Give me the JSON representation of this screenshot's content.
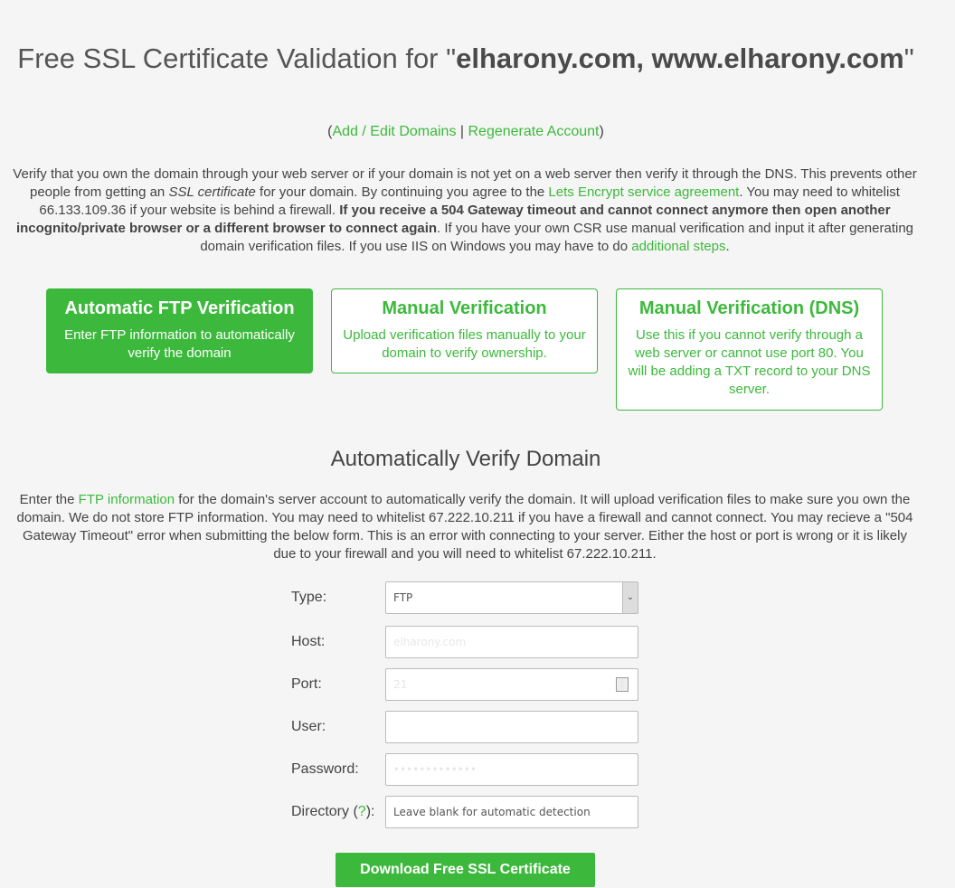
{
  "title": {
    "prefix": "Free SSL Certificate Validation for \"",
    "domains": "elharony.com, www.elharony.com",
    "suffix": "\""
  },
  "links": {
    "open": "(",
    "add_edit": "Add / Edit Domains",
    "sep": " | ",
    "regenerate": "Regenerate Account",
    "close": ")"
  },
  "intro": {
    "t1": "Verify that you own the domain through your web server or if your domain is not yet on a web server then verify it through the DNS. This prevents other people from getting an ",
    "em": "SSL certificate",
    "t2": " for your domain. By continuing you agree to the ",
    "link1": "Lets Encrypt service agreement",
    "t3": ". You may need to whitelist 66.133.109.36 if your website is behind a firewall. ",
    "bold": "If you receive a 504 Gateway timeout and cannot connect anymore then open another incognito/private browser or a different browser to connect again",
    "t4": ". If you have your own CSR use manual verification and input it after generating domain verification files. If you use IIS on Windows you may have to do ",
    "link2": "additional steps",
    "t5": "."
  },
  "cards": [
    {
      "title": "Automatic FTP Verification",
      "text": "Enter FTP information to automatically verify the domain"
    },
    {
      "title": "Manual Verification",
      "text": "Upload verification files manually to your domain to verify ownership."
    },
    {
      "title": "Manual Verification (DNS)",
      "text": "Use this if you cannot verify through a web server or cannot use port 80. You will be adding a TXT record to your DNS server."
    }
  ],
  "section": {
    "heading": "Automatically Verify Domain",
    "d1": "Enter the ",
    "link": "FTP information",
    "d2": " for the domain's server account to automatically verify the domain. It will upload verification files to make sure you own the domain. We do not store FTP information. You may need to whitelist 67.222.10.211 if you have a firewall and cannot connect. You may recieve a \"504 Gateway Timeout\" error when submitting the below form. This is an error with connecting to your server. Either the host or port is wrong or it is likely due to your firewall and you will need to whitelist 67.222.10.211."
  },
  "form": {
    "type_label": "Type:",
    "type_value": "FTP",
    "host_label": "Host:",
    "host_value": "elharony.com",
    "port_label": "Port:",
    "port_value": "21",
    "user_label": "User:",
    "password_label": "Password:",
    "password_value": "•••••••••••••",
    "dir_label": "Directory (",
    "dir_help": "?",
    "dir_close": "):",
    "dir_placeholder": "Leave blank for automatic detection",
    "submit": "Download Free SSL Certificate"
  },
  "colors": {
    "accent": "#3cb93c"
  }
}
